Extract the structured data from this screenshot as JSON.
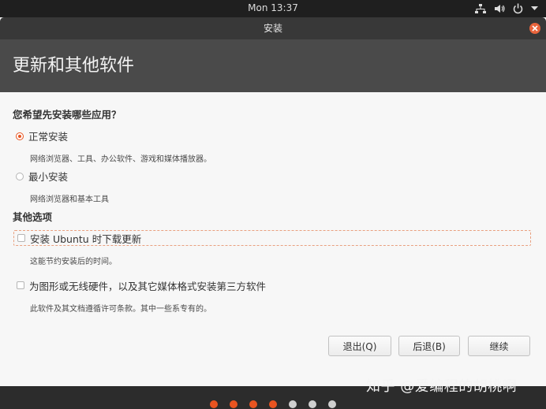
{
  "top_panel": {
    "clock": "Mon 13:37",
    "icons": [
      "network-icon",
      "volume-icon",
      "power-icon",
      "chevron-down-icon"
    ]
  },
  "window": {
    "title": "安装",
    "header": "更新和其他软件"
  },
  "apps": {
    "question": "您希望先安装哪些应用？",
    "normal": {
      "label": "正常安装",
      "desc": "网络浏览器、工具、办公软件、游戏和媒体播放器。",
      "selected": true
    },
    "minimal": {
      "label": "最小安装",
      "desc": "网络浏览器和基本工具",
      "selected": false
    }
  },
  "other": {
    "title": "其他选项",
    "updates": {
      "label": "安装 Ubuntu 时下载更新",
      "desc": "这能节约安装后的时间。",
      "checked": false
    },
    "third_party": {
      "label": "为图形或无线硬件，以及其它媒体格式安装第三方软件",
      "desc": "此软件及其文档遵循许可条款。其中一些系专有的。",
      "checked": false
    }
  },
  "buttons": {
    "quit": "退出(Q)",
    "back": "后退(B)",
    "continue": "继续"
  },
  "progress": {
    "total_steps": 7,
    "completed_steps": 4,
    "done_color": "#e95420",
    "todo_color": "#cfcfcf"
  },
  "watermark": "知乎 @爱编程的胡桃啊",
  "colors": {
    "accent": "#e95420"
  }
}
